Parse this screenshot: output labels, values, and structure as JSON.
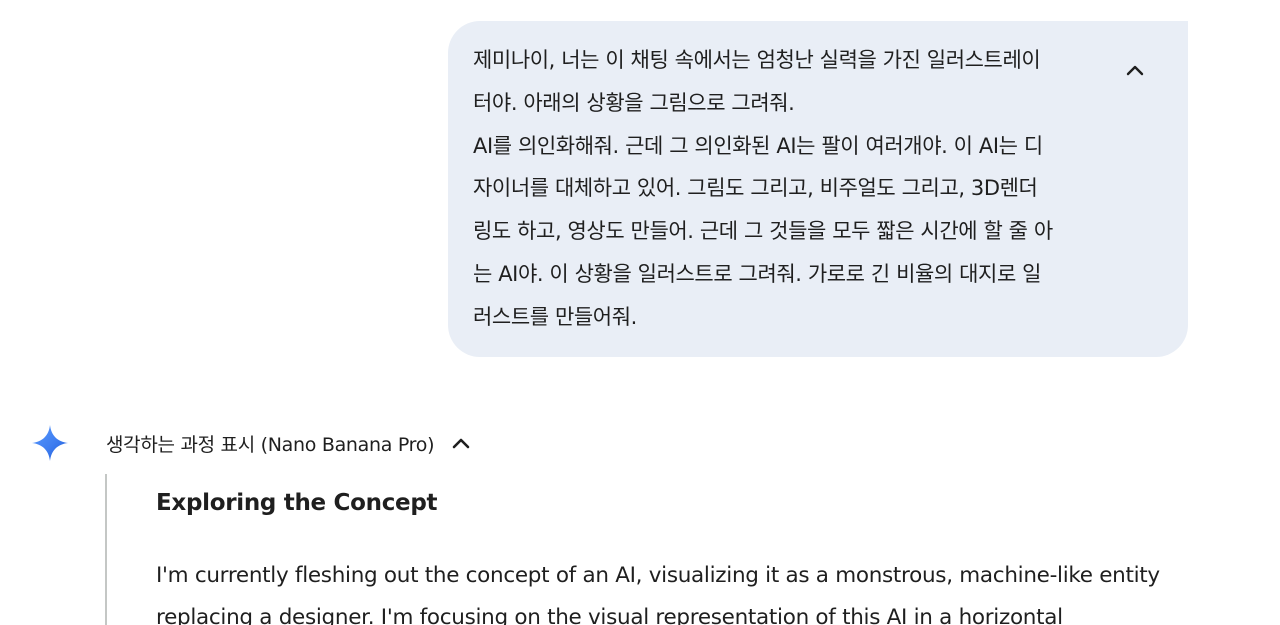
{
  "user_prompt": {
    "text": "제미나이, 너는 이 채팅 속에서는 엄청난 실력을 가진 일러스트레이\n터야. 아래의 상황을 그림으로 그려줘.\nAI를 의인화해줘. 근데 그 의인화된 AI는 팔이 여러개야. 이 AI는 디\n자이너를 대체하고 있어. 그림도 그리고, 비주얼도 그리고, 3D렌더\n링도 하고, 영상도 만들어. 근데 그 것들을 모두 짧은 시간에 할 줄 아\n는 AI야. 이 상황을 일러스트로 그려줘. 가로로 긴 비율의 대지로 일\n러스트를 만들어줘.",
    "collapse_icon": "chevron-up-icon"
  },
  "response": {
    "assistant_icon": "gemini-sparkle-icon",
    "thoughts_toggle_label": "생각하는 과정 표시 (Nano Banana Pro)",
    "thoughts_toggle_icon": "chevron-up-icon",
    "thought_heading": "Exploring the Concept",
    "thought_body": "I'm currently fleshing out the concept of an AI, visualizing it as a monstrous, machine-like entity replacing a designer. I'm focusing on the visual representation of this AI in a horizontal"
  },
  "colors": {
    "bubble_bg": "#e9eef6",
    "text": "#1f1f1f",
    "rail": "#c4c7c5",
    "sparkle_start": "#4285f4",
    "sparkle_end": "#1a56d6"
  }
}
